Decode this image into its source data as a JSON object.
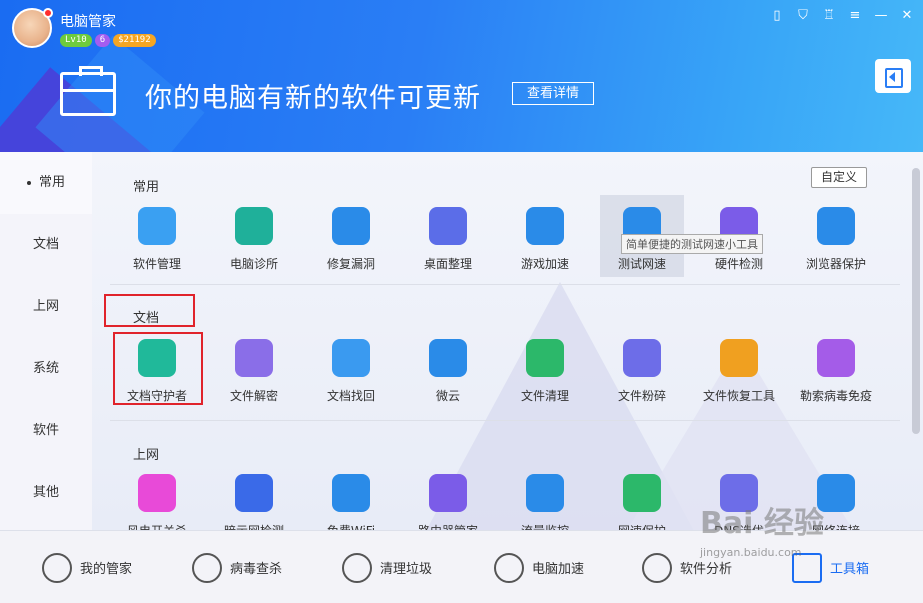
{
  "header": {
    "app_title": "电脑管家",
    "badges": {
      "level": "Lv10",
      "mail": "6",
      "coins": "$21192"
    },
    "banner_text": "你的电脑有新的软件可更新",
    "detail_button": "查看详情",
    "window_controls": [
      "phone-icon",
      "shield-icon",
      "skin-icon",
      "menu-icon",
      "minimize-icon",
      "close-icon"
    ]
  },
  "sidebar": {
    "items": [
      {
        "label": "常用",
        "active": true
      },
      {
        "label": "文档",
        "active": false
      },
      {
        "label": "上网",
        "active": false
      },
      {
        "label": "系统",
        "active": false
      },
      {
        "label": "软件",
        "active": false
      },
      {
        "label": "其他",
        "active": false
      }
    ]
  },
  "main": {
    "customize_button": "自定义",
    "tooltip": "简单便捷的测试网速小工具",
    "sections": [
      {
        "title": "常用",
        "tools": [
          {
            "label": "软件管理",
            "icon": "clover-icon",
            "color": "#3aa0f2"
          },
          {
            "label": "电脑诊所",
            "icon": "stethoscope-icon",
            "color": "#1fb09a"
          },
          {
            "label": "修复漏洞",
            "icon": "windows-repair-icon",
            "color": "#2a8be8"
          },
          {
            "label": "桌面整理",
            "icon": "desktop-icon",
            "color": "#5b6de8"
          },
          {
            "label": "游戏加速",
            "icon": "game-boost-icon",
            "color": "#2a8be8"
          },
          {
            "label": "测试网速",
            "icon": "speedometer-icon",
            "color": "#2a8be8"
          },
          {
            "label": "硬件检测",
            "icon": "chip-icon",
            "color": "#7b5ce8"
          },
          {
            "label": "浏览器保护",
            "icon": "browser-shield-icon",
            "color": "#2a8be8"
          }
        ]
      },
      {
        "title": "文档",
        "tools": [
          {
            "label": "文档守护者",
            "icon": "document-guard-icon",
            "color": "#20b99a"
          },
          {
            "label": "文件解密",
            "icon": "folder-lock-icon",
            "color": "#8a6ee8"
          },
          {
            "label": "文档找回",
            "icon": "document-search-icon",
            "color": "#3a9af0"
          },
          {
            "label": "微云",
            "icon": "weiyun-cloud-icon",
            "color": "#2a8be8"
          },
          {
            "label": "文件清理",
            "icon": "trash-clean-icon",
            "color": "#2cb86a"
          },
          {
            "label": "文件粉碎",
            "icon": "shredder-icon",
            "color": "#6d6de8"
          },
          {
            "label": "文件恢复工具",
            "icon": "restore-clock-icon",
            "color": "#f0a020"
          },
          {
            "label": "勒索病毒免疫",
            "icon": "virus-immune-icon",
            "color": "#a45ce8"
          }
        ]
      },
      {
        "title": "上网",
        "tools": [
          {
            "label": "风电开关杀",
            "icon": "ghost-icon",
            "color": "#e84ad8"
          },
          {
            "label": "暗示网检测",
            "icon": "cloud-search-icon",
            "color": "#3a6ae8"
          },
          {
            "label": "免费WiFi",
            "icon": "free-wifi-icon",
            "color": "#2a8be8"
          },
          {
            "label": "路由器管家",
            "icon": "router-icon",
            "color": "#7b5ce8"
          },
          {
            "label": "流量监控",
            "icon": "traffic-monitor-icon",
            "color": "#2a8be8"
          },
          {
            "label": "网速保护",
            "icon": "speed-shield-icon",
            "color": "#2cb86a"
          },
          {
            "label": "DNS选优",
            "icon": "server-icon",
            "color": "#6d6de8"
          },
          {
            "label": "网络连接",
            "icon": "globe-icon",
            "color": "#2a8be8"
          }
        ]
      }
    ]
  },
  "footer": {
    "items": [
      {
        "label": "我的管家",
        "icon": "butler-icon",
        "active": false
      },
      {
        "label": "病毒查杀",
        "icon": "virus-scan-icon",
        "active": false
      },
      {
        "label": "清理垃圾",
        "icon": "vacuum-icon",
        "active": false
      },
      {
        "label": "电脑加速",
        "icon": "rocket-icon",
        "active": false
      },
      {
        "label": "软件分析",
        "icon": "analysis-icon",
        "active": false
      },
      {
        "label": "工具箱",
        "icon": "toolbox-icon",
        "active": true
      }
    ]
  },
  "watermark": {
    "text": "Bai 经验",
    "sub": "jingyan.baidu.com"
  }
}
